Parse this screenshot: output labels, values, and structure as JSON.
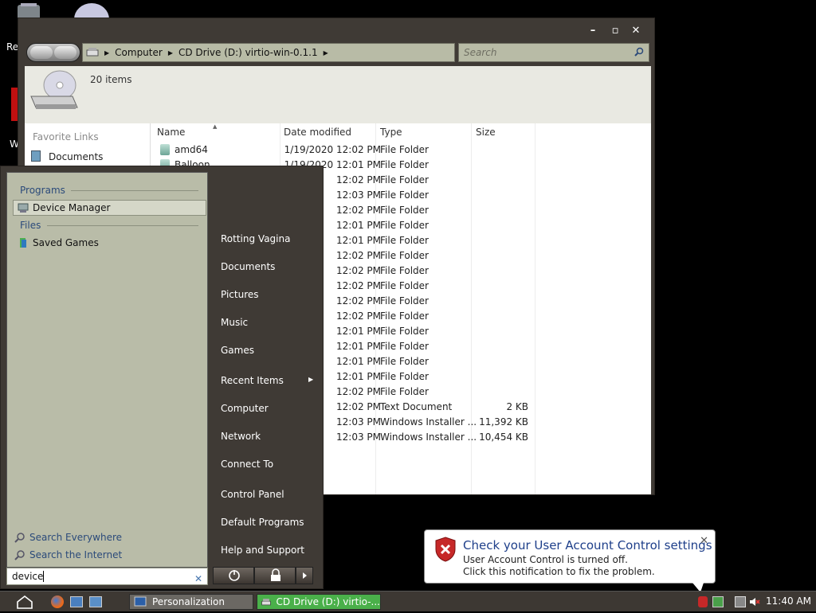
{
  "desktop": {
    "icon_labels": [
      "Re",
      "W"
    ]
  },
  "explorer": {
    "window_controls": {
      "minimize": "–",
      "maximize": "▫",
      "close": "✕"
    },
    "breadcrumb": [
      "Computer",
      "CD Drive (D:) virtio-win-0.1.1"
    ],
    "search_placeholder": "Search",
    "item_count": "20 items",
    "favorite_links_label": "Favorite Links",
    "favorite_links": [
      "Documents"
    ],
    "columns": [
      "Name",
      "Date modified",
      "Type",
      "Size"
    ],
    "rows": [
      {
        "name": "amd64",
        "date": "1/19/2020 12:02 PM",
        "type": "File Folder",
        "size": ""
      },
      {
        "name": "Balloon",
        "date": "1/19/2020 12:01 PM",
        "type": "File Folder",
        "size": ""
      },
      {
        "name": "",
        "date": "12:02 PM",
        "type": "File Folder",
        "size": ""
      },
      {
        "name": "",
        "date": "12:03 PM",
        "type": "File Folder",
        "size": ""
      },
      {
        "name": "",
        "date": "12:02 PM",
        "type": "File Folder",
        "size": ""
      },
      {
        "name": "",
        "date": "12:01 PM",
        "type": "File Folder",
        "size": ""
      },
      {
        "name": "",
        "date": "12:01 PM",
        "type": "File Folder",
        "size": ""
      },
      {
        "name": "",
        "date": "12:02 PM",
        "type": "File Folder",
        "size": ""
      },
      {
        "name": "",
        "date": "12:02 PM",
        "type": "File Folder",
        "size": ""
      },
      {
        "name": "",
        "date": "12:02 PM",
        "type": "File Folder",
        "size": ""
      },
      {
        "name": "",
        "date": "12:02 PM",
        "type": "File Folder",
        "size": ""
      },
      {
        "name": "",
        "date": "12:02 PM",
        "type": "File Folder",
        "size": ""
      },
      {
        "name": "",
        "date": "12:01 PM",
        "type": "File Folder",
        "size": ""
      },
      {
        "name": "",
        "date": "12:01 PM",
        "type": "File Folder",
        "size": ""
      },
      {
        "name": "",
        "date": "12:01 PM",
        "type": "File Folder",
        "size": ""
      },
      {
        "name": "",
        "date": "12:01 PM",
        "type": "File Folder",
        "size": ""
      },
      {
        "name": "",
        "date": "12:02 PM",
        "type": "File Folder",
        "size": ""
      },
      {
        "name": "",
        "date": "12:02 PM",
        "type": "Text Document",
        "size": "2 KB"
      },
      {
        "name": "",
        "date": "12:03 PM",
        "type": "Windows Installer ...",
        "size": "11,392 KB"
      },
      {
        "name": "",
        "date": "12:03 PM",
        "type": "Windows Installer ...",
        "size": "10,454 KB"
      }
    ]
  },
  "start_menu": {
    "programs_label": "Programs",
    "program_results": [
      "Device Manager"
    ],
    "files_label": "Files",
    "file_results": [
      "Saved Games"
    ],
    "search_links": [
      "Search Everywhere",
      "Search the Internet"
    ],
    "search_value": "device",
    "clear_glyph": "✕",
    "right_items": [
      "Rotting Vagina",
      "Documents",
      "Pictures",
      "Music",
      "Games",
      "Recent Items",
      "Computer",
      "Network",
      "Connect To",
      "Control Panel",
      "Default Programs",
      "Help and Support"
    ],
    "recent_items_arrow": "▶"
  },
  "taskbar": {
    "buttons": [
      "Personalization",
      "CD Drive (D:) virtio-..."
    ],
    "clock": "11:40 AM"
  },
  "balloon": {
    "title": "Check your User Account Control settings",
    "line1": "User Account Control is turned off.",
    "line2": "Click this notification to fix the problem.",
    "close": "✕"
  },
  "colors": {
    "chrome": "#3f3a35",
    "pane": "#b9bca8",
    "link": "#2b4a7a",
    "balloon_title": "#1e3f8a"
  }
}
